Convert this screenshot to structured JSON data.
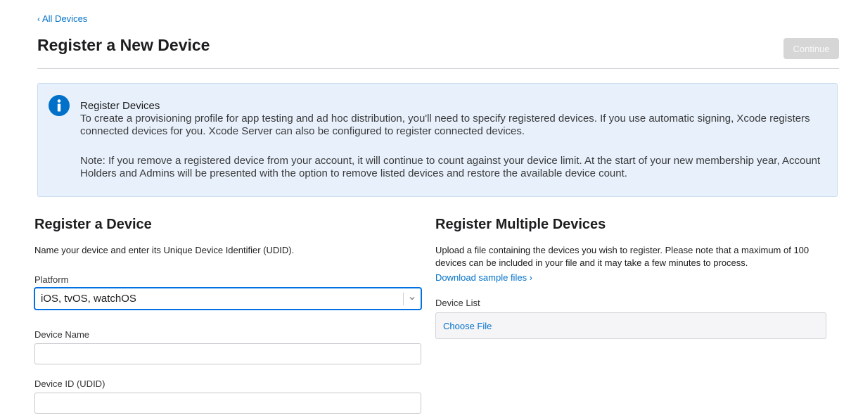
{
  "nav": {
    "back_label": "All Devices"
  },
  "header": {
    "title": "Register a New Device",
    "continue_label": "Continue"
  },
  "info": {
    "heading": "Register Devices",
    "body": "To create a provisioning profile for app testing and ad hoc distribution, you'll need to specify registered devices. If you use automatic signing, Xcode registers connected devices for you. Xcode Server can also be configured to register connected devices.",
    "note": "Note: If you remove a registered device from your account, it will continue to count against your device limit. At the start of your new membership year, Account Holders and Admins will be presented with the option to remove listed devices and restore the available device count.",
    "icon": "info-circle-icon",
    "accent_color": "#0070c9"
  },
  "single": {
    "title": "Register a Device",
    "description": "Name your device and enter its Unique Device Identifier (UDID).",
    "platform_label": "Platform",
    "platform_value": "iOS, tvOS, watchOS",
    "device_name_label": "Device Name",
    "device_name_value": "",
    "device_id_label": "Device ID (UDID)",
    "device_id_value": ""
  },
  "multiple": {
    "title": "Register Multiple Devices",
    "description": "Upload a file containing the devices you wish to register. Please note that a maximum of 100 devices can be included in your file and it may take a few minutes to process.",
    "download_link": "Download sample files ›",
    "device_list_label": "Device List",
    "choose_file_label": "Choose File"
  }
}
